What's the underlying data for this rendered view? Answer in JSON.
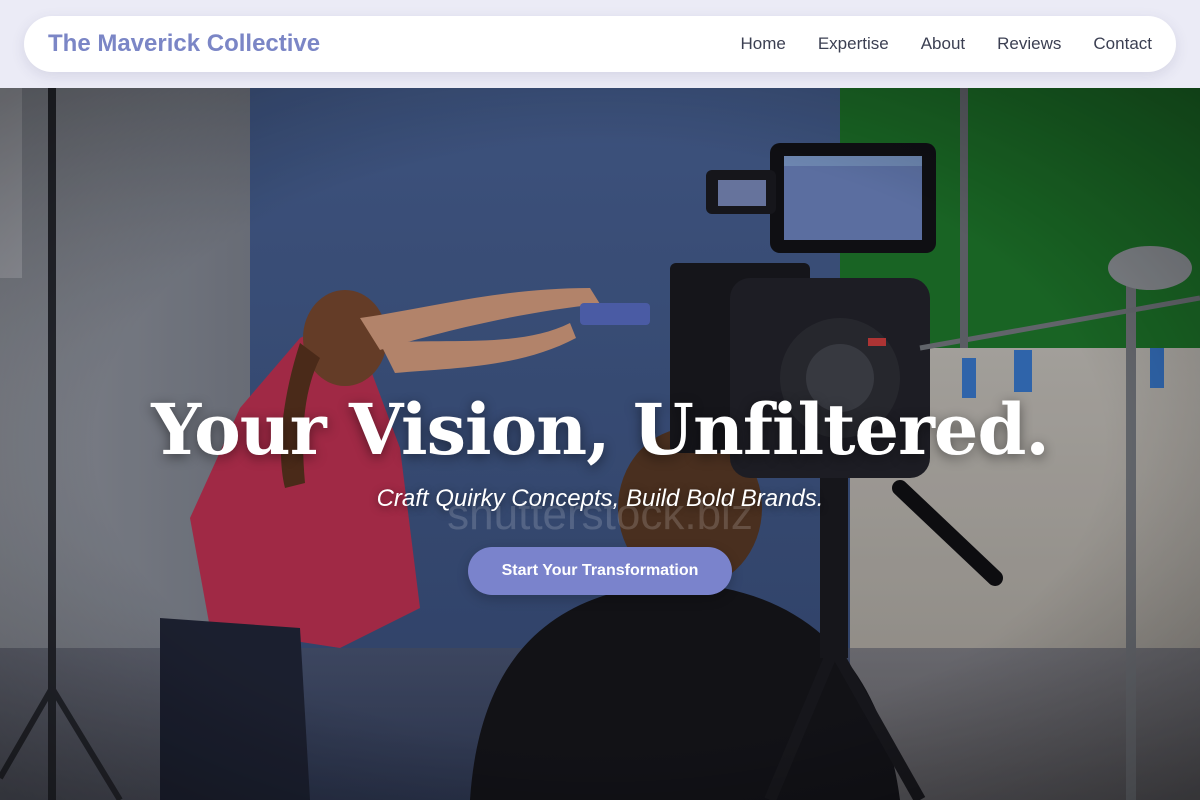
{
  "header": {
    "brand": "The Maverick Collective",
    "nav": [
      "Home",
      "Expertise",
      "About",
      "Reviews",
      "Contact"
    ]
  },
  "hero": {
    "title": "Your Vision, Unfiltered.",
    "subtitle": "Craft Quirky Concepts, Build Bold Brands.",
    "cta_label": "Start Your Transformation",
    "watermark": "shutterstock.biz",
    "image": "film-studio-camera-crew-photo"
  },
  "colors": {
    "brand": "#7b86c6",
    "cta": "#7a83cc",
    "nav_text": "#3b3f52",
    "page_bg": "#ebebf6"
  }
}
